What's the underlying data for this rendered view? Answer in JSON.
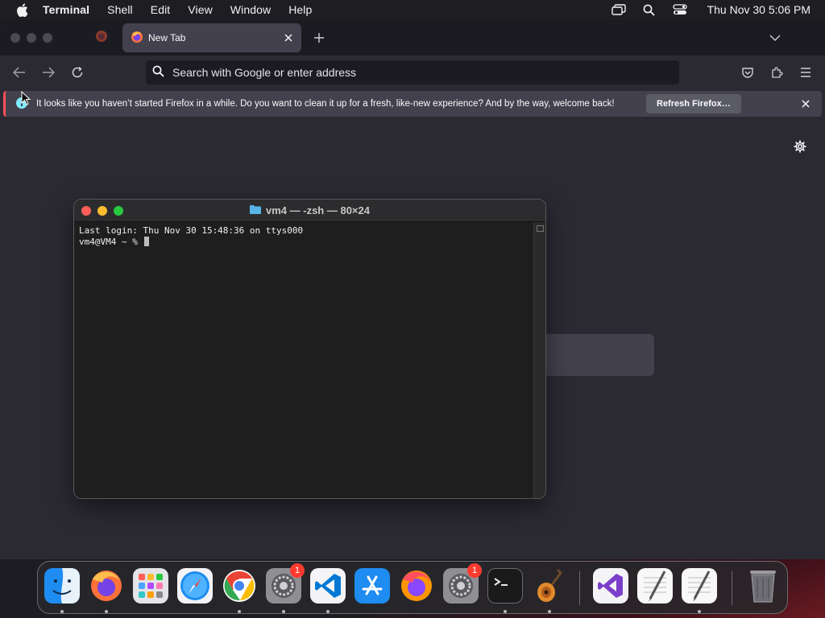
{
  "menubar": {
    "app_name": "Terminal",
    "items": [
      "Shell",
      "Edit",
      "View",
      "Window",
      "Help"
    ],
    "clock": "Thu Nov 30  5:06 PM"
  },
  "firefox": {
    "active_tab_title": "New Tab",
    "urlbar_placeholder": "Search with Google or enter address",
    "notification": {
      "message": "It looks like you haven’t started Firefox in a while. Do you want to clean it up for a fresh, like-new experience? And by the way, welcome back!",
      "button_label": "Refresh Firefox…"
    }
  },
  "terminal": {
    "title": "vm4 — -zsh — 80×24",
    "lines": [
      "Last login: Thu Nov 30 15:48:36 on ttys000",
      "vm4@VM4 ~ % "
    ]
  },
  "dock": {
    "items": [
      {
        "name": "finder",
        "icon": "finder-icon"
      },
      {
        "name": "firefox",
        "icon": "firefox-icon"
      },
      {
        "name": "launchpad",
        "icon": "launchpad-icon"
      },
      {
        "name": "safari",
        "icon": "safari-icon"
      },
      {
        "name": "chrome",
        "icon": "chrome-icon"
      },
      {
        "name": "system-settings",
        "icon": "gear-icon",
        "badge": "1"
      },
      {
        "name": "vscode",
        "icon": "vscode-icon"
      },
      {
        "name": "app-store",
        "icon": "app-store-icon"
      },
      {
        "name": "firefox-2",
        "icon": "firefox-icon"
      },
      {
        "name": "system-settings-2",
        "icon": "gear-icon",
        "badge": "1"
      },
      {
        "name": "terminal",
        "icon": "terminal-icon"
      },
      {
        "name": "garageband",
        "icon": "guitar-icon"
      },
      {
        "name": "visual-studio",
        "icon": "visual-studio-icon"
      },
      {
        "name": "textedit",
        "icon": "textedit-icon"
      },
      {
        "name": "textedit-2",
        "icon": "textedit-icon"
      },
      {
        "name": "trash",
        "icon": "trash-icon"
      }
    ]
  },
  "colors": {
    "close": "#ff5f57",
    "minimize": "#febc2e",
    "zoom": "#28c840",
    "firefox_bg": "#2b2a33",
    "badge": "#ff3b30"
  }
}
